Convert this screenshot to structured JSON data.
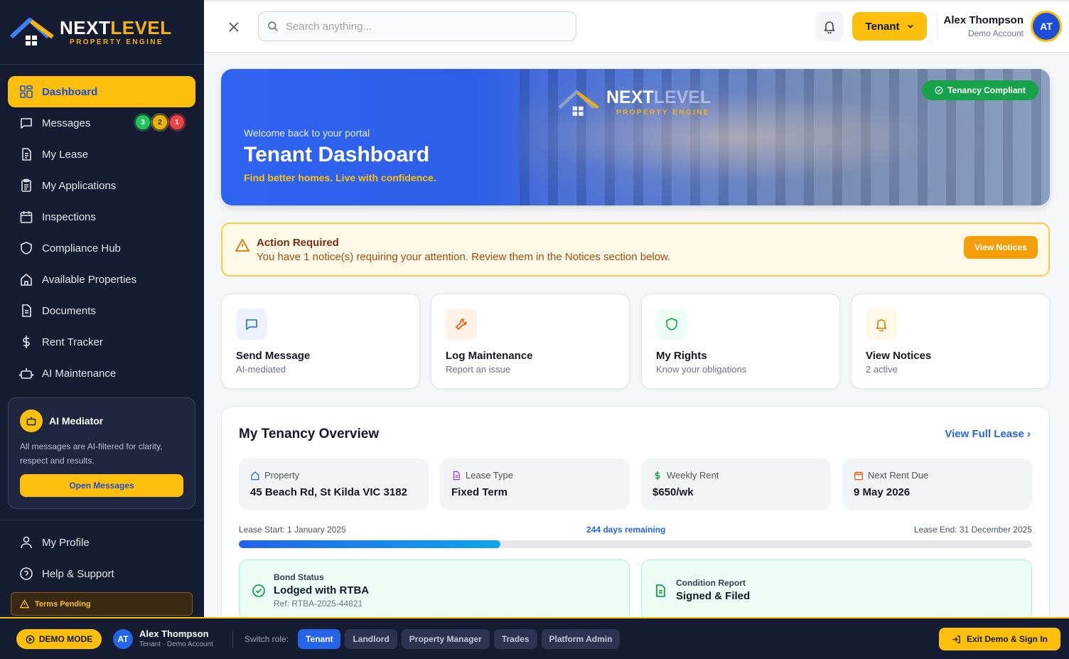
{
  "brand": {
    "name_part1": "NEXT",
    "name_part2": "LEVEL",
    "tagline": "PROPERTY ENGINE"
  },
  "sidebar": {
    "items": [
      {
        "label": "Dashboard",
        "icon": "dashboard-icon",
        "active": true
      },
      {
        "label": "Messages",
        "icon": "message-icon"
      },
      {
        "label": "My Lease",
        "icon": "document-icon"
      },
      {
        "label": "My Applications",
        "icon": "clipboard-icon"
      },
      {
        "label": "Inspections",
        "icon": "calendar-icon"
      },
      {
        "label": "Compliance Hub",
        "icon": "shield-icon"
      },
      {
        "label": "Available Properties",
        "icon": "home-icon"
      },
      {
        "label": "Documents",
        "icon": "file-icon"
      },
      {
        "label": "Rent Tracker",
        "icon": "dollar-icon"
      },
      {
        "label": "AI Maintenance",
        "icon": "robot-icon"
      }
    ],
    "message_badges": {
      "green": "3",
      "yellow": "2",
      "red": "1"
    },
    "mediator": {
      "title": "AI Mediator",
      "text": "All messages are AI-filtered for clarity, respect and results.",
      "button": "Open Messages"
    },
    "bottom_items": [
      {
        "label": "My Profile",
        "icon": "user-icon"
      },
      {
        "label": "Help & Support",
        "icon": "help-icon"
      }
    ],
    "terms": "Terms Pending"
  },
  "header": {
    "search_placeholder": "Search anything...",
    "role": "Tenant",
    "user_name": "Alex Thompson",
    "user_sub": "Demo Account",
    "avatar_initials": "AT"
  },
  "hero": {
    "logo_part1": "NEXT",
    "logo_part2": "LEVEL",
    "logo_sub": "PROPERTY ENGINE",
    "welcome": "Welcome back to your portal",
    "title": "Tenant Dashboard",
    "tagline": "Find better homes. Live with confidence.",
    "status": "Tenancy Compliant"
  },
  "action": {
    "title": "Action Required",
    "text": "You have 1 notice(s) requiring your attention. Review them in the Notices section below.",
    "button": "View Notices"
  },
  "quick_actions": [
    {
      "title": "Send Message",
      "sub": "AI-mediated",
      "icon": "message-icon"
    },
    {
      "title": "Log Maintenance",
      "sub": "Report an issue",
      "icon": "wrench-icon"
    },
    {
      "title": "My Rights",
      "sub": "Know your obligations",
      "icon": "shield-icon"
    },
    {
      "title": "View Notices",
      "sub": "2 active",
      "icon": "bell-icon"
    }
  ],
  "overview": {
    "title": "My Tenancy Overview",
    "link": "View Full Lease",
    "info": [
      {
        "label": "Property",
        "value": "45 Beach Rd, St Kilda VIC 3182",
        "icon": "home-icon"
      },
      {
        "label": "Lease Type",
        "value": "Fixed Term",
        "icon": "document-icon"
      },
      {
        "label": "Weekly Rent",
        "value": "$650/wk",
        "icon": "dollar-icon"
      },
      {
        "label": "Next Rent Due",
        "value": "9 May 2026",
        "icon": "calendar-icon"
      }
    ],
    "lease_start": "Lease Start: 1 January 2025",
    "days_remaining": "244 days remaining",
    "lease_end": "Lease End: 31 December 2025",
    "progress_percent": 33,
    "bond": {
      "label": "Bond Status",
      "value": "Lodged with RTBA",
      "ref": "Ref: RTBA-2025-44821"
    },
    "condition": {
      "label": "Condition Report",
      "value": "Signed & Filed"
    }
  },
  "demobar": {
    "mode": "DEMO MODE",
    "avatar": "AT",
    "name": "Alex Thompson",
    "sub": "Tenant · Demo Account",
    "switch_label": "Switch role:",
    "roles": [
      "Tenant",
      "Landlord",
      "Property Manager",
      "Trades",
      "Platform Admin"
    ],
    "exit": "Exit Demo & Sign In"
  },
  "colors": {
    "accent": "#fcc00c",
    "primary": "#2563eb",
    "sidebar": "#161d33"
  }
}
